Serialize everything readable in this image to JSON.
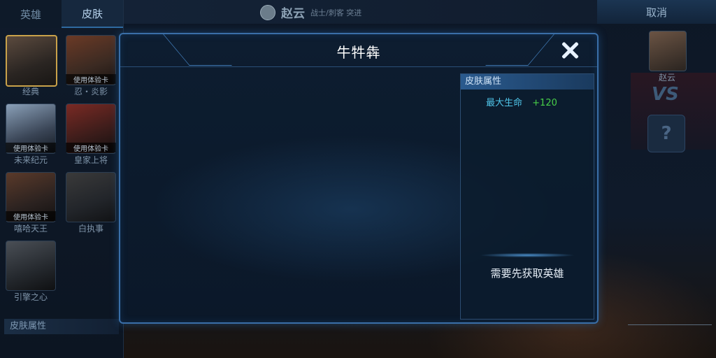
{
  "left_panel": {
    "tabs": [
      {
        "label": "英雄"
      },
      {
        "label": "皮肤"
      }
    ],
    "skins": [
      {
        "label": "经典",
        "trial": ""
      },
      {
        "label": "忍・炎影",
        "trial": "使用体验卡"
      },
      {
        "label": "未来纪元",
        "trial": "使用体验卡"
      },
      {
        "label": "皇家上将",
        "trial": "使用体验卡"
      },
      {
        "label": "嘻哈天王",
        "trial": "使用体验卡"
      },
      {
        "label": "白执事",
        "trial": ""
      },
      {
        "label": "引擎之心",
        "trial": ""
      }
    ],
    "attr_label": "皮肤属性"
  },
  "top_bar": {
    "hero_name": "赵云",
    "hero_roles": "战士/刺客 突进",
    "cancel_label": "取消"
  },
  "right_side": {
    "avatar_name": "赵云",
    "vs_text": "VS",
    "mystery_text": "?"
  },
  "modal": {
    "title": "牛牪犇",
    "attr_panel": {
      "header": "皮肤属性",
      "stat_name": "最大生命",
      "stat_value": "+120",
      "note": "需要先获取英雄"
    }
  },
  "colors": {
    "modal_border": "#3a6fa8",
    "stat_name": "#4fc4e8",
    "stat_value": "#48d048",
    "selected_card_border": "#c9a24a"
  }
}
